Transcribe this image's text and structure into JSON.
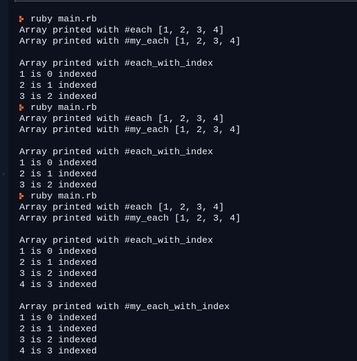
{
  "prompt": {
    "icon": "prompt-arrow-icon",
    "color": "#f26b1d"
  },
  "lines": [
    {
      "type": "command",
      "text": "ruby main.rb"
    },
    {
      "type": "output",
      "text": "Array printed with #each [1, 2, 3, 4]"
    },
    {
      "type": "output",
      "text": "Array printed with #my_each [1, 2, 3, 4]"
    },
    {
      "type": "blank",
      "text": ""
    },
    {
      "type": "output",
      "text": "Array printed with #each_with_index"
    },
    {
      "type": "output",
      "text": "1 is 0 indexed"
    },
    {
      "type": "output",
      "text": "2 is 1 indexed"
    },
    {
      "type": "output",
      "text": "3 is 2 indexed"
    },
    {
      "type": "command",
      "text": "ruby main.rb"
    },
    {
      "type": "output",
      "text": "Array printed with #each [1, 2, 3, 4]"
    },
    {
      "type": "output",
      "text": "Array printed with #my_each [1, 2, 3, 4]"
    },
    {
      "type": "blank",
      "text": ""
    },
    {
      "type": "output",
      "text": "Array printed with #each_with_index"
    },
    {
      "type": "output",
      "text": "1 is 0 indexed"
    },
    {
      "type": "output",
      "text": "2 is 1 indexed"
    },
    {
      "type": "output",
      "text": "3 is 2 indexed"
    },
    {
      "type": "command",
      "text": "ruby main.rb"
    },
    {
      "type": "output",
      "text": "Array printed with #each [1, 2, 3, 4]"
    },
    {
      "type": "output",
      "text": "Array printed with #my_each [1, 2, 3, 4]"
    },
    {
      "type": "blank",
      "text": ""
    },
    {
      "type": "output",
      "text": "Array printed with #each_with_index"
    },
    {
      "type": "output",
      "text": "1 is 0 indexed"
    },
    {
      "type": "output",
      "text": "2 is 1 indexed"
    },
    {
      "type": "output",
      "text": "3 is 2 indexed"
    },
    {
      "type": "output",
      "text": "4 is 3 indexed"
    },
    {
      "type": "blank",
      "text": ""
    },
    {
      "type": "output",
      "text": "Array printed with #my_each_with_index"
    },
    {
      "type": "output",
      "text": "1 is 0 indexed"
    },
    {
      "type": "output",
      "text": "2 is 1 indexed"
    },
    {
      "type": "output",
      "text": "3 is 2 indexed"
    },
    {
      "type": "output",
      "text": "4 is 3 indexed"
    }
  ],
  "gutter": {
    "icon": "chevron-right-icon",
    "glyph": "›"
  }
}
